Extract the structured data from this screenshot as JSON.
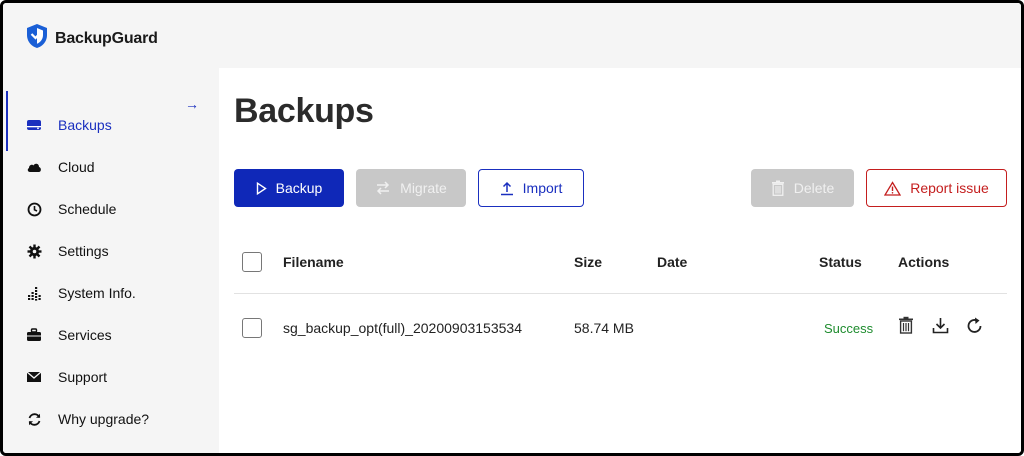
{
  "app": {
    "name": "BackupGuard"
  },
  "sidebar": {
    "collapse_icon": "arrow-right-icon",
    "items": [
      {
        "label": "Backups",
        "icon": "drive-icon",
        "active": true
      },
      {
        "label": "Cloud",
        "icon": "cloud-icon"
      },
      {
        "label": "Schedule",
        "icon": "clock-icon"
      },
      {
        "label": "Settings",
        "icon": "gear-icon"
      },
      {
        "label": "System Info.",
        "icon": "bars-icon"
      },
      {
        "label": "Services",
        "icon": "briefcase-icon"
      },
      {
        "label": "Support",
        "icon": "envelope-icon"
      },
      {
        "label": "Why upgrade?",
        "icon": "refresh-icon"
      }
    ]
  },
  "main": {
    "title": "Backups",
    "buttons": {
      "backup": "Backup",
      "migrate": "Migrate",
      "import": "Import",
      "delete": "Delete",
      "report": "Report issue"
    },
    "table": {
      "headers": {
        "filename": "Filename",
        "size": "Size",
        "date": "Date",
        "status": "Status",
        "actions": "Actions"
      },
      "rows": [
        {
          "filename": "sg_backup_opt(full)_20200903153534",
          "size": "58.74 MB",
          "date": "",
          "status": "Success"
        }
      ]
    }
  },
  "colors": {
    "accent": "#0f28b8",
    "danger": "#c41e1e",
    "success": "#1e8c2e",
    "disabled": "#c8c8c8"
  }
}
